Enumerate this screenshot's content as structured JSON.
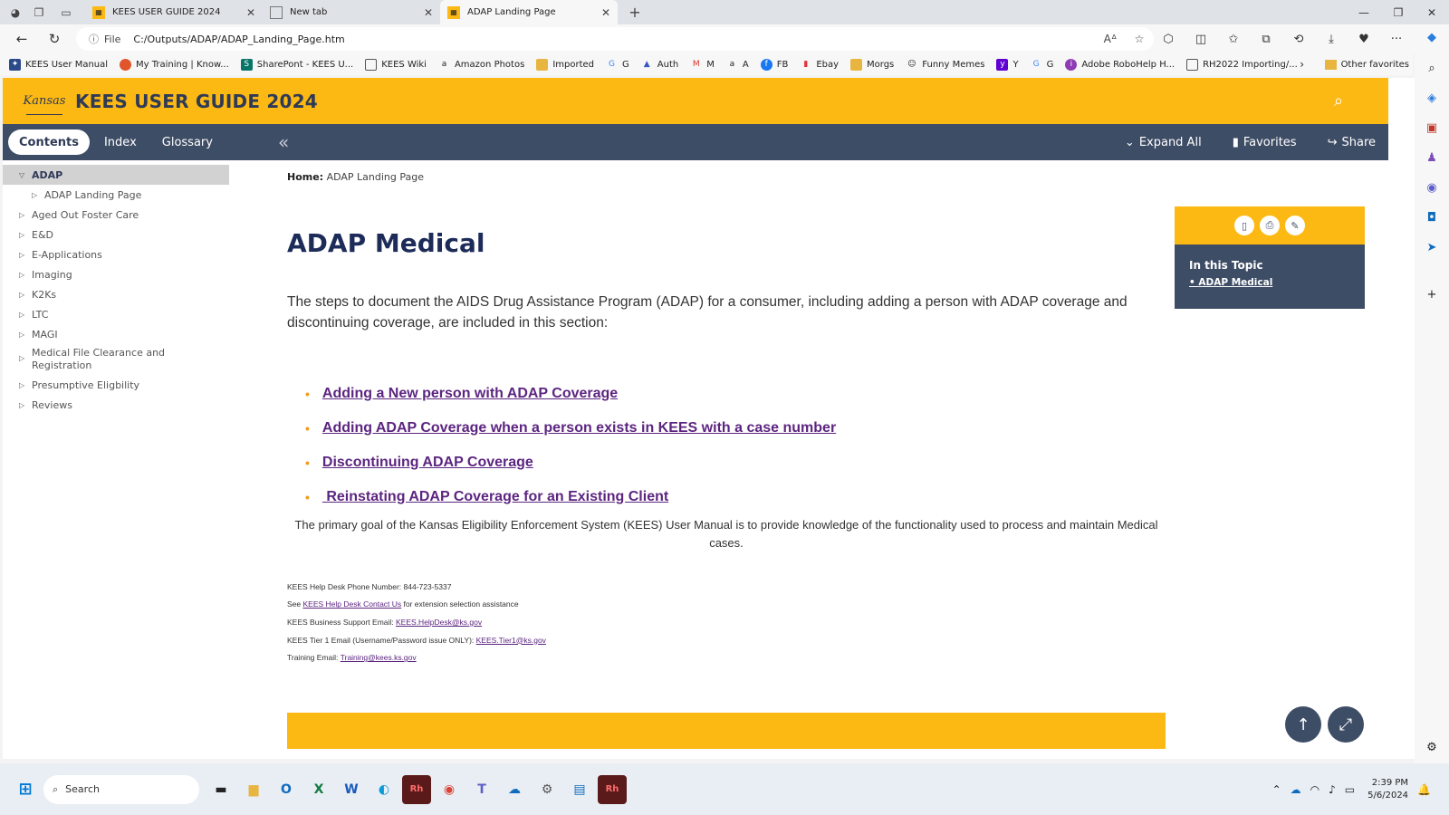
{
  "browser": {
    "tabs": [
      {
        "title": "KEES USER GUIDE 2024",
        "active": false
      },
      {
        "title": "New tab",
        "active": false
      },
      {
        "title": "ADAP Landing Page",
        "active": true
      }
    ],
    "address_scheme": "File",
    "url": "C:/Outputs/ADAP/ADAP_Landing_Page.htm",
    "favorites": [
      "KEES User Manual",
      "My Training | Know...",
      "SharePont - KEES U...",
      "KEES Wiki",
      "Amazon Photos",
      "Imported",
      "G",
      "Auth",
      "M",
      "A",
      "FB",
      "Ebay",
      "Morgs",
      "Funny Memes",
      "Y",
      "G",
      "Adobe RoboHelp H...",
      "RH2022 Importing/..."
    ],
    "other_favorites": "Other favorites"
  },
  "site": {
    "logo_text": "Kansas",
    "title": "KEES USER GUIDE 2024"
  },
  "nav": {
    "tabs": [
      "Contents",
      "Index",
      "Glossary"
    ],
    "expand_all": "Expand All",
    "favorites": "Favorites",
    "share": "Share"
  },
  "toc": [
    {
      "label": "ADAP",
      "state": "expanded",
      "selected": true
    },
    {
      "label": "ADAP Landing Page",
      "state": "collapsed",
      "sub": true
    },
    {
      "label": "Aged Out Foster Care",
      "state": "collapsed"
    },
    {
      "label": "E&D",
      "state": "collapsed"
    },
    {
      "label": "E-Applications",
      "state": "collapsed"
    },
    {
      "label": "Imaging",
      "state": "collapsed"
    },
    {
      "label": "K2Ks",
      "state": "collapsed"
    },
    {
      "label": "LTC",
      "state": "collapsed"
    },
    {
      "label": "MAGI",
      "state": "collapsed"
    },
    {
      "label": "Medical File Clearance and Registration",
      "state": "collapsed",
      "two_line": true
    },
    {
      "label": "Presumptive Eligbility",
      "state": "collapsed"
    },
    {
      "label": "Reviews",
      "state": "collapsed"
    }
  ],
  "breadcrumb": {
    "home": "Home:",
    "current": "ADAP Landing Page"
  },
  "content": {
    "heading": "ADAP Medical",
    "intro": "The steps to document the AIDS Drug Assistance Program (ADAP)  for a consumer, including adding a person with ADAP coverage and discontinuing coverage, are included in this section:",
    "links": [
      "Adding a New person with ADAP Coverage",
      "Adding ADAP Coverage when a person exists in KEES with a case number",
      "Discontinuing ADAP Coverage",
      " Reinstating ADAP Coverage for an Existing Client"
    ],
    "goal": "The primary goal of the Kansas Eligibility Enforcement System (KEES) User Manual is to provide knowledge of the functionality used to process and maintain Medical cases.",
    "contact": {
      "phone": "KEES Help Desk Phone Number: 844-723-5337",
      "see_pre": "See ",
      "see_link": "KEES Help Desk Contact Us",
      "see_post": " for extension selection assistance",
      "business_pre": "KEES Business Support Email: ",
      "business_link": "KEES.HelpDesk@ks.gov",
      "tier1_pre": "KEES Tier 1 Email (Username/Password issue ONLY): ",
      "tier1_link": "KEES.Tier1@ks.gov",
      "training_pre": "Training Email: ",
      "training_link": "Training@kees.ks.gov"
    }
  },
  "topic_panel": {
    "title": "In this Topic",
    "link": "ADAP Medical"
  },
  "taskbar": {
    "search_placeholder": "Search",
    "time": "2:39 PM",
    "date": "5/6/2024"
  },
  "colors": {
    "brand_yellow": "#fcb913",
    "nav_slate": "#3e4d66",
    "heading_navy": "#1d2b59",
    "link_purple": "#5c2580",
    "bullet_orange": "#f29b1e"
  }
}
